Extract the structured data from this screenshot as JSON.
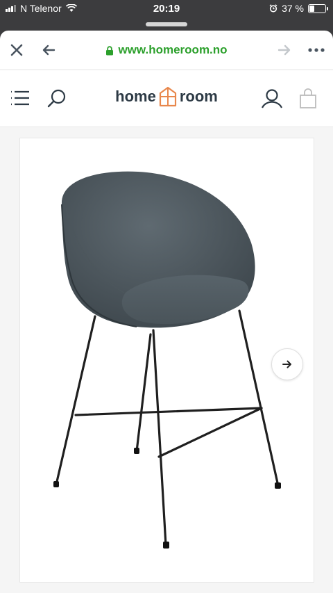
{
  "status_bar": {
    "carrier": "N Telenor",
    "time": "20:19",
    "battery_text": "37 %",
    "battery_level": 0.37
  },
  "browser": {
    "url": "www.homeroom.no",
    "close_icon": "close-icon",
    "back_icon": "back-arrow-icon",
    "forward_icon": "forward-arrow-icon",
    "more_icon": "more-icon",
    "url_color": "#2ca02c"
  },
  "site_header": {
    "logo_left": "home",
    "logo_right": "room",
    "logo_accent": "#e8874c",
    "menu_icon": "menu-icon",
    "search_icon": "search-icon",
    "account_icon": "account-icon",
    "cart_icon": "cart-icon"
  },
  "product": {
    "image": "bar-stool-photo",
    "next_icon": "arrow-right-icon"
  }
}
